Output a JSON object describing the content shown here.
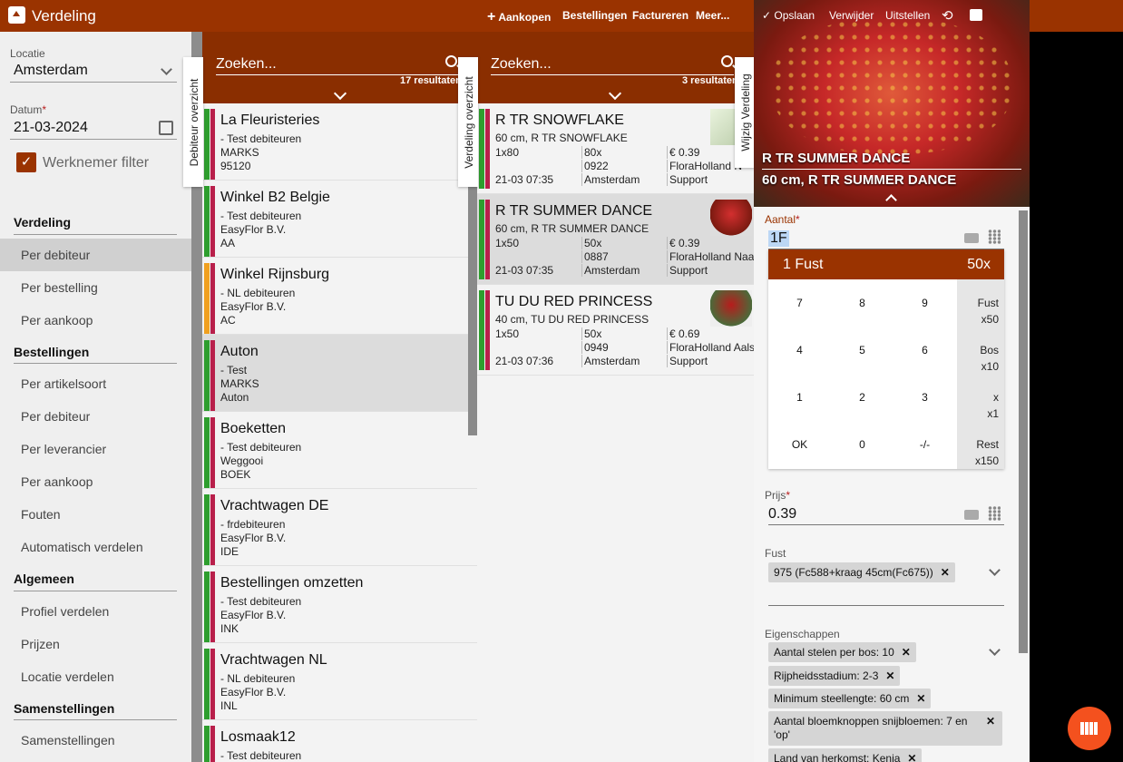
{
  "app": {
    "title": "Verdeling"
  },
  "topnav": {
    "add_purchase": "Aankopen",
    "orders": "Bestellingen",
    "invoice": "Factureren",
    "more": "Meer..."
  },
  "sidebar": {
    "location_label": "Locatie",
    "location_value": "Amsterdam",
    "date_label": "Datum",
    "date_value": "21-03-2024",
    "employee_filter": "Werknemer filter",
    "sections": [
      {
        "title": "Verdeling",
        "items": [
          "Per debiteur",
          "Per bestelling",
          "Per aankoop"
        ]
      },
      {
        "title": "Bestellingen",
        "items": [
          "Per artikelsoort",
          "Per debiteur",
          "Per leverancier",
          "Per aankoop",
          "Fouten",
          "Automatisch verdelen"
        ]
      },
      {
        "title": "Algemeen",
        "items": [
          "Profiel verdelen",
          "Prijzen",
          "Locatie verdelen"
        ]
      },
      {
        "title": "Samenstellingen",
        "items": [
          "Samenstellingen"
        ]
      }
    ]
  },
  "debtor_tab": "Debiteur overzicht",
  "debtors": {
    "search_placeholder": "Zoeken...",
    "results": "17 resultaten",
    "rows": [
      {
        "name": "La Fleuristeries",
        "l1": "- Test debiteuren",
        "l2": "MARKS",
        "l3": "95120",
        "color": "#2e9e2e"
      },
      {
        "name": "Winkel B2 Belgie",
        "l1": "- Test debiteuren",
        "l2": "EasyFlor B.V.",
        "l3": "AA",
        "color": "#2e9e2e"
      },
      {
        "name": "Winkel Rijnsburg",
        "l1": "- NL debiteuren",
        "l2": "EasyFlor B.V.",
        "l3": "AC",
        "color": "#f0a020"
      },
      {
        "name": "Auton",
        "l1": "- Test",
        "l2": "MARKS",
        "l3": "Auton",
        "color": "#2e9e2e"
      },
      {
        "name": "Boeketten",
        "l1": "- Test debiteuren",
        "l2": "Weggooi",
        "l3": "BOEK",
        "color": "#2e9e2e"
      },
      {
        "name": "Vrachtwagen DE",
        "l1": "- frdebiteuren",
        "l2": "EasyFlor B.V.",
        "l3": "IDE",
        "color": "#2e9e2e"
      },
      {
        "name": "Bestellingen omzetten",
        "l1": "- Test debiteuren",
        "l2": "EasyFlor B.V.",
        "l3": "INK",
        "color": "#2e9e2e"
      },
      {
        "name": "Vrachtwagen NL",
        "l1": "- NL debiteuren",
        "l2": "EasyFlor B.V.",
        "l3": "INL",
        "color": "#2e9e2e"
      },
      {
        "name": "Losmaak12",
        "l1": "- Test debiteuren",
        "l2": "",
        "l3": "",
        "color": "#2e9e2e"
      }
    ]
  },
  "distribution_tab": "Verdeling overzicht",
  "products": {
    "search_placeholder": "Zoeken...",
    "results": "3 resultaten",
    "rows": [
      {
        "name": "R TR SNOWFLAKE",
        "desc": "60 cm, R TR SNOWFLAKE",
        "a1": "1x80",
        "a2": "21-03 07:35",
        "b1": "80x",
        "b2": "0922",
        "b3": "Amsterdam",
        "c1": "€ 0.39",
        "c2": "FloraHolland N",
        "c3": "Support"
      },
      {
        "name": "R TR SUMMER DANCE",
        "desc": "60 cm, R TR SUMMER DANCE",
        "a1": "1x50",
        "a2": "21-03 07:35",
        "b1": "50x",
        "b2": "0887",
        "b3": "Amsterdam",
        "c1": "€ 0.39",
        "c2": "FloraHolland Naa",
        "c3": "Support"
      },
      {
        "name": "TU DU RED PRINCESS",
        "desc": "40 cm, TU DU RED PRINCESS",
        "a1": "1x50",
        "a2": "21-03 07:36",
        "b1": "50x",
        "b2": "0949",
        "b3": "Amsterdam",
        "c1": "€ 0.69",
        "c2": "FloraHolland Aals",
        "c3": "Support"
      }
    ]
  },
  "edit_tab": "Wijzig Verdeling",
  "panel": {
    "save": "Opslaan",
    "delete": "Verwijder",
    "postpone": "Uitstellen",
    "title": "R TR SUMMER DANCE",
    "subtitle": "60 cm, R TR SUMMER DANCE",
    "qty_label": "Aantal",
    "qty_value": "1F",
    "keypad_left": "1 Fust",
    "keypad_right": "50x",
    "keys": [
      "7",
      "8",
      "9",
      "4",
      "5",
      "6",
      "1",
      "2",
      "3",
      "OK",
      "0",
      "-/-"
    ],
    "side_keys": [
      {
        "l": "Fust",
        "r": "x50"
      },
      {
        "l": "Bos",
        "r": "x10"
      },
      {
        "l": "x",
        "r": "x1"
      },
      {
        "l": "Rest",
        "r": "x150"
      }
    ],
    "price_label": "Prijs",
    "price_value": "0.39",
    "fust_label": "Fust",
    "fust_chip": "975 (Fc588+kraag 45cm(Fc675))",
    "props_label": "Eigenschappen",
    "props": [
      "Aantal stelen per bos: 10",
      "Rijpheidsstadium: 2-3",
      "Minimum steellengte: 60 cm",
      "Aantal bloemknoppen snijbloemen: 7 en 'op'",
      "Land van herkomst: Kenia"
    ]
  },
  "colors": {
    "brand": "#9a3300",
    "header_dark": "#8a2e00",
    "fab": "#f4511e",
    "green": "#2e9e2e",
    "crimson": "#b81f4a",
    "orange": "#f0a020"
  }
}
